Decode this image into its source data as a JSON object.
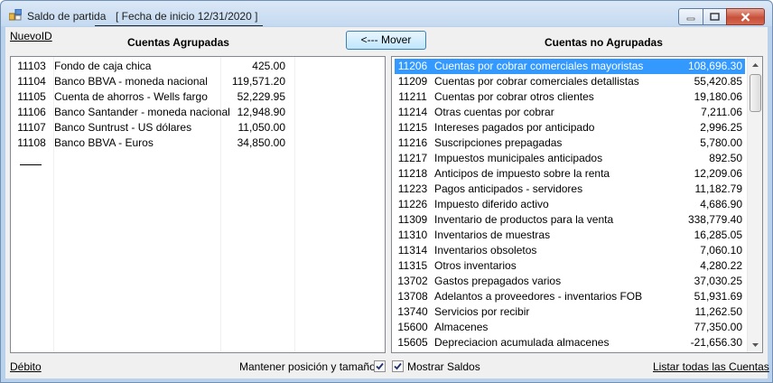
{
  "window": {
    "title": "Saldo de partida",
    "subtitle": "[ Fecha de inicio 12/31/2020 ]"
  },
  "toolbar": {
    "new_id_link": "NuevoID",
    "move_button": "<--- Mover"
  },
  "left_panel": {
    "heading": "Cuentas Agrupadas",
    "rows": [
      {
        "id": "11103",
        "name": "Fondo de caja chica",
        "amount": "425.00"
      },
      {
        "id": "11104",
        "name": "Banco BBVA - moneda nacional",
        "amount": "119,571.20"
      },
      {
        "id": "11105",
        "name": "Cuenta de ahorros - Wells fargo",
        "amount": "52,229.95"
      },
      {
        "id": "11106",
        "name": "Banco Santander - moneda nacional",
        "amount": "12,948.90"
      },
      {
        "id": "11107",
        "name": "Banco Suntrust - US dólares",
        "amount": "11,050.00"
      },
      {
        "id": "11108",
        "name": "Banco BBVA - Euros",
        "amount": "34,850.00"
      }
    ]
  },
  "right_panel": {
    "heading": "Cuentas no Agrupadas",
    "selected_index": 0,
    "rows": [
      {
        "id": "11206",
        "name": "Cuentas por cobrar comerciales mayoristas",
        "amount": "108,696.30"
      },
      {
        "id": "11209",
        "name": "Cuentas por cobrar comerciales detallistas",
        "amount": "55,420.85"
      },
      {
        "id": "11211",
        "name": "Cuentas por cobrar otros clientes",
        "amount": "19,180.06"
      },
      {
        "id": "11214",
        "name": "Otras cuentas por cobrar",
        "amount": "7,211.06"
      },
      {
        "id": "11215",
        "name": "Intereses pagados por anticipado",
        "amount": "2,996.25"
      },
      {
        "id": "11216",
        "name": "Suscripciones prepagadas",
        "amount": "5,780.00"
      },
      {
        "id": "11217",
        "name": "Impuestos municipales anticipados",
        "amount": "892.50"
      },
      {
        "id": "11218",
        "name": "Anticipos de impuesto sobre la renta",
        "amount": "12,209.06"
      },
      {
        "id": "11223",
        "name": "Pagos anticipados - servidores",
        "amount": "11,182.79"
      },
      {
        "id": "11226",
        "name": "Impuesto diferido activo",
        "amount": "4,686.90"
      },
      {
        "id": "11309",
        "name": "Inventario de productos para la venta",
        "amount": "338,779.40"
      },
      {
        "id": "11310",
        "name": "Inventarios de muestras",
        "amount": "16,285.05"
      },
      {
        "id": "11314",
        "name": "Inventarios obsoletos",
        "amount": "7,060.10"
      },
      {
        "id": "11315",
        "name": "Otros inventarios",
        "amount": "4,280.22"
      },
      {
        "id": "13702",
        "name": "Gastos prepagados varios",
        "amount": "37,030.25"
      },
      {
        "id": "13708",
        "name": "Adelantos a proveedores - inventarios FOB",
        "amount": "51,931.69"
      },
      {
        "id": "13740",
        "name": "Servicios por recibir",
        "amount": "11,262.50"
      },
      {
        "id": "15600",
        "name": "Almacenes",
        "amount": "77,350.00"
      },
      {
        "id": "15605",
        "name": "Depreciacion acumulada almacenes",
        "amount": "-21,656.30"
      }
    ]
  },
  "footer": {
    "debit_link": "Débito",
    "keep_position_label": "Mantener posición y tamaño",
    "keep_position_checked": true,
    "show_balances_label": "Mostrar Saldos",
    "show_balances_checked": true,
    "list_all_link": "Listar todas las Cuentas"
  },
  "colors": {
    "selection": "#3399ff",
    "window_frame": "#b9d1ea",
    "close_button": "#c7503a"
  }
}
